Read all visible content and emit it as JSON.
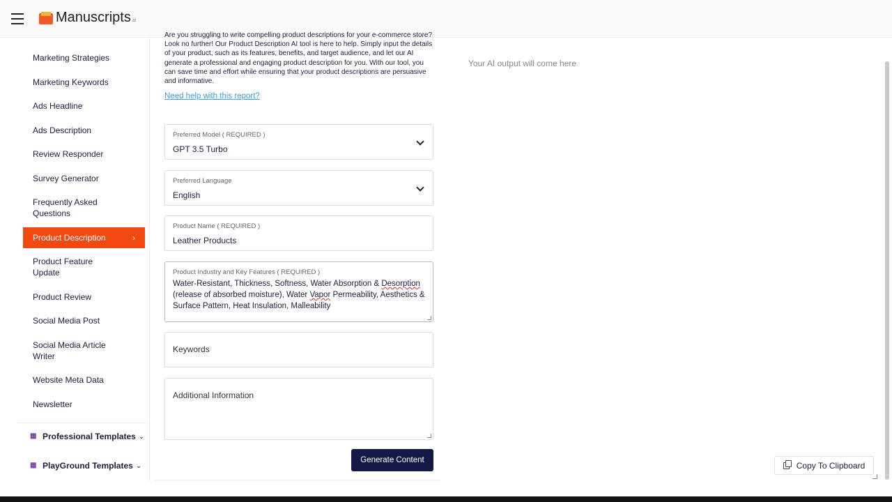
{
  "app": {
    "brand": "Manuscripts",
    "brand_sup": "ai"
  },
  "sidebar": {
    "items": [
      {
        "label": "Marketing Strategies"
      },
      {
        "label": "Marketing Keywords"
      },
      {
        "label": "Ads Headline"
      },
      {
        "label": "Ads Description"
      },
      {
        "label": "Review Responder"
      },
      {
        "label": "Survey Generator"
      },
      {
        "label": "Frequently Asked Questions"
      },
      {
        "label": "Product Description",
        "active": true
      },
      {
        "label": "Product Feature Update"
      },
      {
        "label": "Product Review"
      },
      {
        "label": "Social Media Post"
      },
      {
        "label": "Social Media Article Writer"
      },
      {
        "label": "Website Meta Data"
      },
      {
        "label": "Newsletter"
      }
    ],
    "groups": [
      {
        "label": "Professional Templates",
        "icon": "template-icon"
      },
      {
        "label": "PlayGround Templates",
        "icon": "grid-icon"
      }
    ],
    "active_color": "#f04a12"
  },
  "form": {
    "intro": "Are you struggling to write compelling product descriptions for your e-commerce store? Look no further! Our Product Description AI tool is here to help. Simply input the details of your product, such as its features, benefits, and target audience, and let our AI generate a professional and engaging product description for you. With our tool, you can save time and effort while ensuring that your product descriptions are persuasive and informative.",
    "help_link": "Need help with this report?",
    "model": {
      "label": "Preferred Model ( REQUIRED )",
      "value": "GPT 3.5 Turbo"
    },
    "language": {
      "label": "Preferred Language",
      "value": "English"
    },
    "product_name": {
      "label": "Product Name ( REQUIRED )",
      "value": "Leather Products"
    },
    "features": {
      "label": "Product Industry and Key Features ( REQUIRED )",
      "value_part1": "Water-Resistant, Thickness, Softness, Water Absorption & ",
      "value_misspelled1": "Desorption",
      "value_part2": " (release of absorbed moisture), Water ",
      "value_misspelled2": "Vapor",
      "value_part3": " Permeability, Aesthetics & Surface Pattern, Heat Insulation, Malleability"
    },
    "keywords": {
      "placeholder": "Keywords"
    },
    "additional": {
      "placeholder": "Additional Information"
    },
    "generate_label": "Generate Content",
    "generate_color": "#141a45"
  },
  "output": {
    "placeholder": "Your AI output will come here",
    "copy_label": "Copy To Clipboard"
  }
}
